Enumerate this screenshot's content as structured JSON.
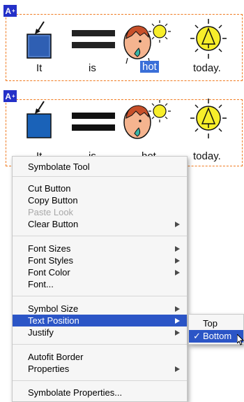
{
  "panels": [
    {
      "badge": "A",
      "badge_sup": "+",
      "words": [
        "It",
        "is",
        "hot",
        "today."
      ],
      "selected_word_index": 2
    },
    {
      "badge": "A",
      "badge_sup": "+",
      "words": [
        "It",
        "is",
        "hot",
        "today."
      ]
    }
  ],
  "context_menu": {
    "items": [
      {
        "label": "Symbolate Tool",
        "submenu": false,
        "enabled": true
      },
      {
        "label": "Cut Button",
        "submenu": false,
        "enabled": true
      },
      {
        "label": "Copy Button",
        "submenu": false,
        "enabled": true
      },
      {
        "label": "Paste Look",
        "submenu": false,
        "enabled": false
      },
      {
        "label": "Clear Button",
        "submenu": true,
        "enabled": true
      },
      {
        "label": "Font Sizes",
        "submenu": true,
        "enabled": true
      },
      {
        "label": "Font Styles",
        "submenu": true,
        "enabled": true
      },
      {
        "label": "Font Color",
        "submenu": true,
        "enabled": true
      },
      {
        "label": "Font...",
        "submenu": false,
        "enabled": true
      },
      {
        "label": "Symbol Size",
        "submenu": true,
        "enabled": true
      },
      {
        "label": "Text Position",
        "submenu": true,
        "enabled": true,
        "highlighted": true
      },
      {
        "label": "Justify",
        "submenu": true,
        "enabled": true
      },
      {
        "label": "Autofit Border",
        "submenu": false,
        "enabled": true
      },
      {
        "label": "Properties",
        "submenu": true,
        "enabled": true
      },
      {
        "label": "Symbolate Properties...",
        "submenu": false,
        "enabled": true
      }
    ]
  },
  "submenu": {
    "items": [
      {
        "label": "Top",
        "checked": false
      },
      {
        "label": "Bottom",
        "checked": true,
        "highlighted": true
      }
    ],
    "check_glyph": "✓"
  },
  "colors": {
    "border": "#f07a20",
    "badge": "#2430c8",
    "selection": "#3a6fd8",
    "menu_highlight": "#2b55c6"
  },
  "icons": [
    "plus-icon",
    "arrow-pointer-icon",
    "face-sweat-icon",
    "sun-icon",
    "sun-tree-icon",
    "mouse-cursor-icon"
  ]
}
